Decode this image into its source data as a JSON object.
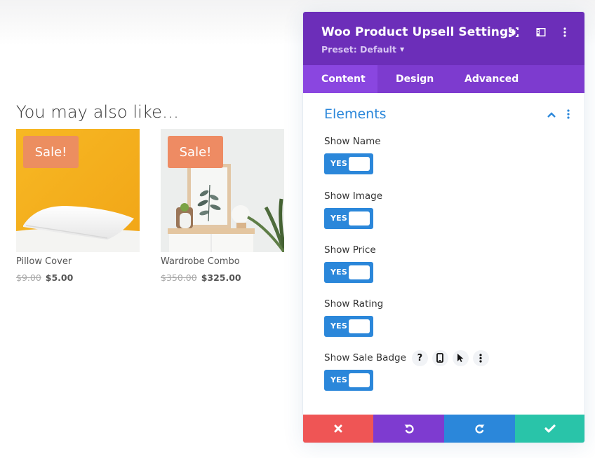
{
  "page": {
    "section_title": "You may also like…",
    "products": [
      {
        "name": "Pillow Cover",
        "badge": "Sale!",
        "price_old": "$9.00",
        "price_new": "$5.00",
        "image": "white-pillow-on-yellow-background"
      },
      {
        "name": "Wardrobe Combo",
        "badge": "Sale!",
        "price_old": "$350.00",
        "price_new": "$325.00",
        "image": "sideboard-with-framed-plant-print"
      }
    ]
  },
  "modal": {
    "title": "Woo Product Upsell Settings",
    "preset_label": "Preset: Default",
    "header_icons": [
      "expand-icon",
      "sidebar-layout-icon",
      "more-options-icon"
    ],
    "tabs": [
      {
        "label": "Content",
        "active": true
      },
      {
        "label": "Design",
        "active": false
      },
      {
        "label": "Advanced",
        "active": false
      }
    ],
    "group": {
      "title": "Elements",
      "expanded": true
    },
    "fields": [
      {
        "label": "Show Name",
        "value": "YES",
        "on": true
      },
      {
        "label": "Show Image",
        "value": "YES",
        "on": true
      },
      {
        "label": "Show Price",
        "value": "YES",
        "on": true
      },
      {
        "label": "Show Rating",
        "value": "YES",
        "on": true
      },
      {
        "label": "Show Sale Badge",
        "value": "YES",
        "on": true
      }
    ],
    "field_tools": {
      "help": "?",
      "icons": [
        "help-icon",
        "responsive-phone-icon",
        "hover-cursor-icon",
        "more-options-icon"
      ]
    },
    "footer": {
      "discard": "discard-x-icon",
      "undo": "undo-icon",
      "redo": "redo-icon",
      "save": "save-check-icon"
    },
    "colors": {
      "header": "#6c2eb9",
      "tabs": "#7d3bcf",
      "active_tab": "#8a46e0",
      "accent_blue": "#2b87da",
      "discard_red": "#ef5555",
      "undo_purple": "#7e3bd0",
      "save_green": "#29c4a9",
      "sale_badge": "#ee8b63"
    }
  }
}
